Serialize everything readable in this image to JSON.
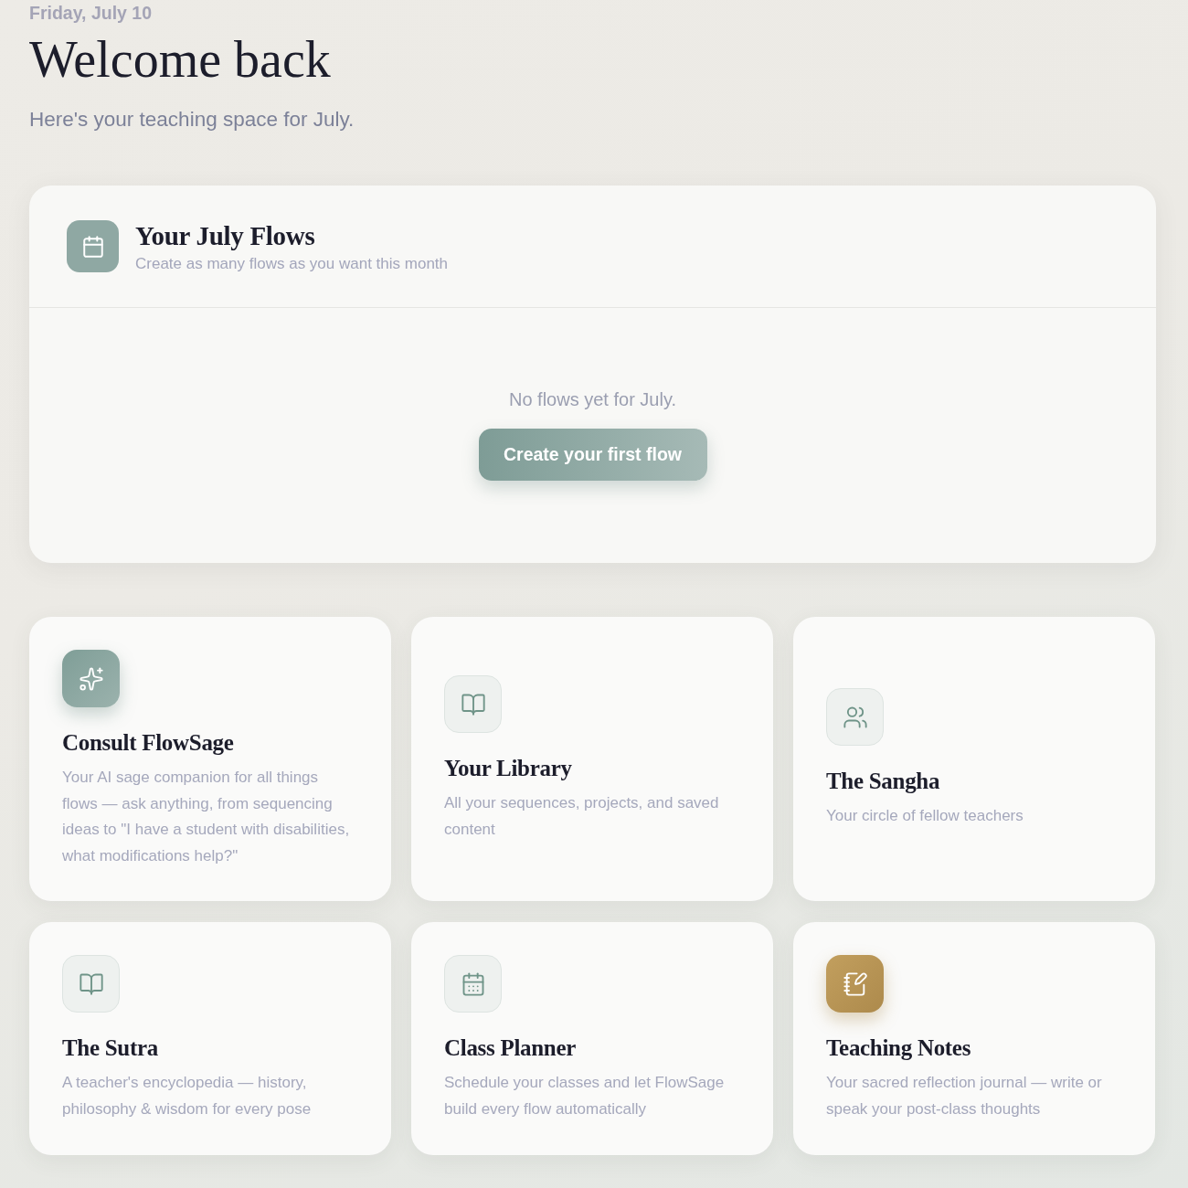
{
  "header": {
    "date": "Friday, July 10",
    "title": "Welcome back",
    "subtitle": "Here's your teaching space for July."
  },
  "flows_panel": {
    "title": "Your July Flows",
    "subtitle": "Create as many flows as you want this month",
    "empty_message": "No flows yet for July.",
    "button": "Create your first flow"
  },
  "cards": [
    {
      "kind": "accent",
      "title": "Consult FlowSage",
      "description": "Your AI sage companion for all things flows — ask anything, from sequencing ideas to \"I have a student with disabilities, what modifications help?\""
    },
    {
      "kind": "plain",
      "title": "Your Library",
      "description": "All your sequences, projects, and saved content"
    },
    {
      "kind": "plain",
      "title": "The Sangha",
      "description": "Your circle of fellow teachers"
    },
    {
      "kind": "plain",
      "title": "The Sutra",
      "description": "A teacher's encyclopedia — history, philosophy & wisdom for every pose"
    },
    {
      "kind": "plain",
      "title": "Class Planner",
      "description": "Schedule your classes and let FlowSage build every flow automatically"
    },
    {
      "kind": "gold",
      "title": "Teaching Notes",
      "description": "Your sacred reflection journal — write or speak your post-class thoughts"
    }
  ]
}
